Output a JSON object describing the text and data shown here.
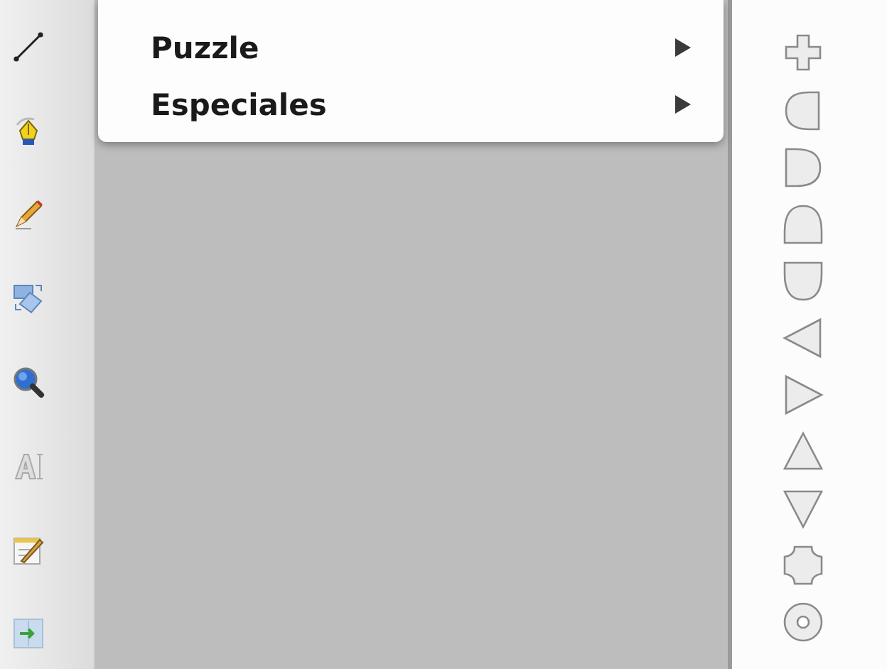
{
  "menu": {
    "items": [
      {
        "label": "Puzzle",
        "has_submenu": true
      },
      {
        "label": "Especiales",
        "has_submenu": true
      }
    ]
  }
}
